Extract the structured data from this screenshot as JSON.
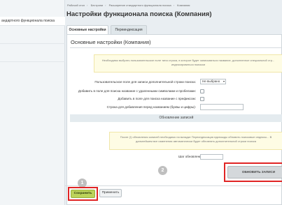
{
  "sidebar": {
    "active_item": "андартного функционала поиска"
  },
  "breadcrumb": [
    "Рабочий стол",
    "Бестрани",
    "Расширение стандартного функционала поиска",
    "Компания"
  ],
  "page": {
    "title": "Настройки функционала поиска (Компания)",
    "star": "☆"
  },
  "tabs": [
    {
      "label": "Основные настройки",
      "active": true
    },
    {
      "label": "Переиндексация",
      "active": false
    }
  ],
  "main": {
    "section_title": "Основные настройки (Компания)",
    "notice": "Необходимо выбрать пользовательское поле типа строка, в которое будет записываться название, дополненное специальной стр... индексироваться поиском"
  },
  "form": {
    "field_label": "Пользовательское поле для записи дополнительной строки поиска:",
    "field_value": "Не выбрано",
    "check1_label": "Добавить в поле для поиска название с удаленными символами и пробелами:",
    "check2_label": "Добавить в поле для поиска название с префиксом:",
    "prefix_label": "Строка для добавления перед названием (буквы и цифры):"
  },
  "update": {
    "heading": "Обновление записей",
    "notice": "После (!) обновления записей необходимо на вкладке Переиндексация единожды обновить поисковые индексы... В дальнейшем все изменения автоматически будет обновлять дополнительной строки поиска",
    "step_label": "Шаг обновления:",
    "button_label": "ОБНОВИТЬ ЗАПИСИ"
  },
  "actions": {
    "save_label": "Сохранить",
    "apply_label": "Применить"
  },
  "badges": {
    "one": "1",
    "two": "2"
  },
  "colors": {
    "highlight": "#e02424",
    "save_button": "#bcd35a",
    "notice_bg": "#fefce4"
  }
}
